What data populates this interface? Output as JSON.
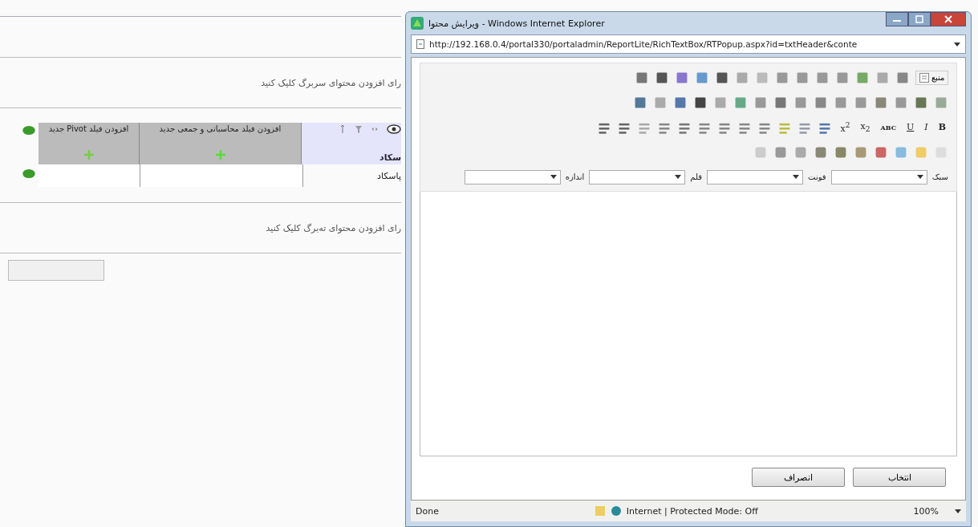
{
  "page": {
    "header_hint": "رای افزودن محتوای سربرگ کلیک کنید",
    "table": {
      "columns": [
        "افزودن فیلد محاسباتی و جمعی جدید",
        "افزودن فیلد Pivot جدید"
      ],
      "header_label": "سکاد",
      "row_label": "پاسکاد"
    },
    "footer_hint": "رای افزودن محتوای ته‌برگ کلیک کنید"
  },
  "popup": {
    "title": "ویرایش محتوا - Windows Internet Explorer",
    "url": "http://192.168.0.4/portal330/portaladmin/ReportLite/RichTextBox/RTPopup.aspx?id=txtHeader&conte",
    "source_button": "منبع",
    "format_buttons": [
      {
        "label": "B",
        "kind": "bold"
      },
      {
        "label": "I",
        "kind": "italic"
      },
      {
        "label": "U",
        "kind": "underline"
      },
      {
        "label": "ABC",
        "kind": "strike"
      },
      {
        "label": "x$_{2}$",
        "kind": "plain"
      },
      {
        "label": "x$^{2}$",
        "kind": "plain"
      }
    ],
    "dropdowns": [
      {
        "label": "سبک"
      },
      {
        "label": "فونت"
      },
      {
        "label": "قلم"
      },
      {
        "label": "اندازه"
      }
    ],
    "buttons": [
      "انتخاب",
      "انصراف"
    ],
    "status": {
      "text": "Done",
      "zone": "Internet | Protected Mode: Off",
      "zoom": "100%"
    }
  }
}
